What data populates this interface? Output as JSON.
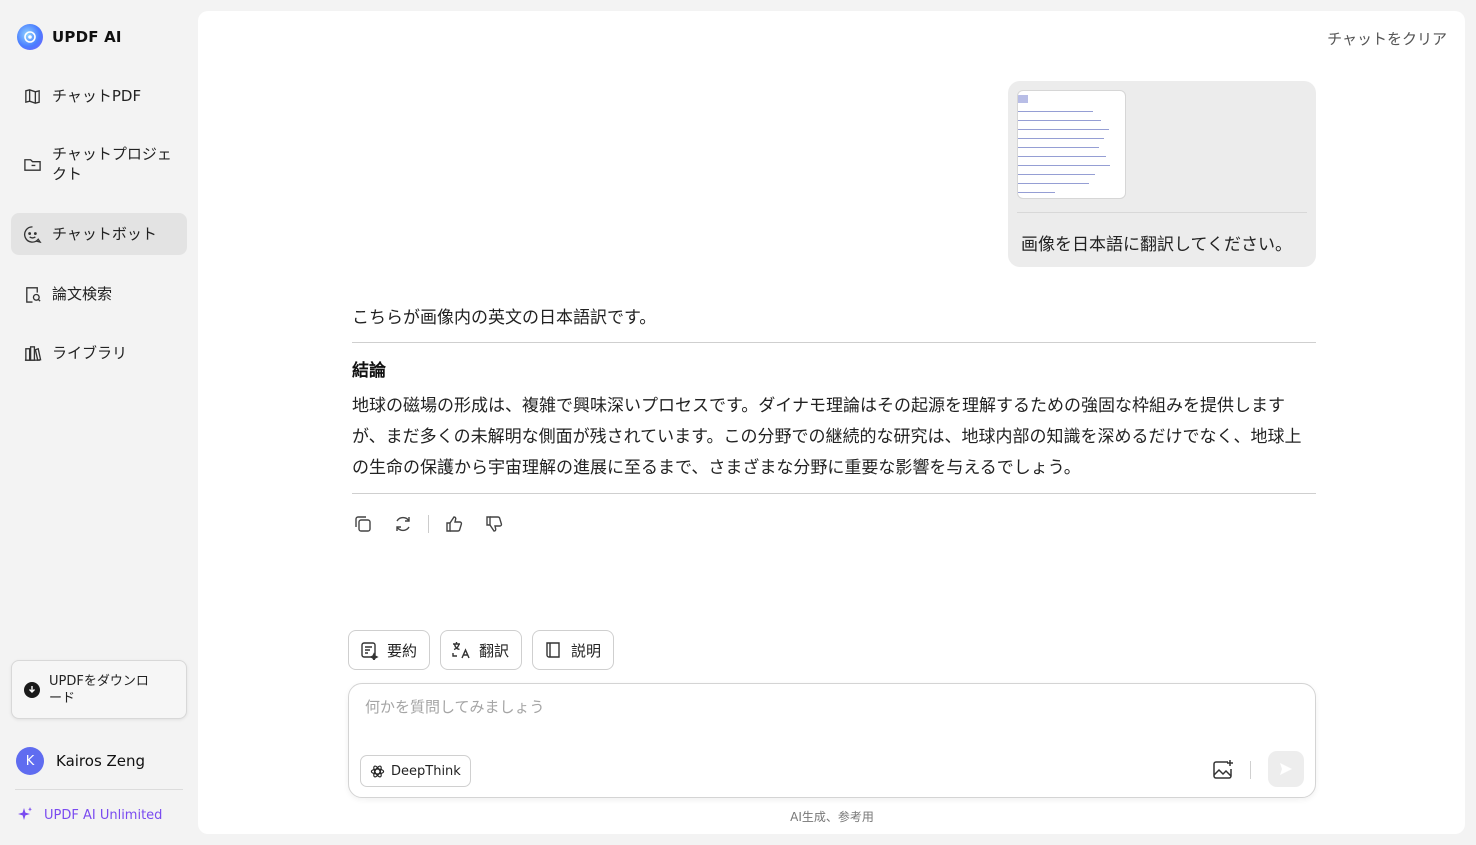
{
  "brand": {
    "name": "UPDF AI"
  },
  "sidebar": {
    "items": [
      {
        "label": "チャットPDF",
        "icon": "chat-pdf-icon"
      },
      {
        "label": "チャットプロジェクト",
        "icon": "folder-icon"
      },
      {
        "label": "チャットボット",
        "icon": "chatbot-icon"
      },
      {
        "label": "論文検索",
        "icon": "paper-search-icon"
      },
      {
        "label": "ライブラリ",
        "icon": "library-icon"
      }
    ],
    "active": "チャットボット",
    "download_label": "UPDFをダウンロード",
    "user": {
      "initial": "K",
      "name": "Kairos Zeng"
    },
    "plan": "UPDF AI Unlimited"
  },
  "header": {
    "clear_label": "チャットをクリア"
  },
  "conversation": {
    "user_message": "画像を日本語に翻訳してください。",
    "assistant": {
      "intro": "こちらが画像内の英文の日本語訳です。",
      "heading": "結論",
      "body": "地球の磁場の形成は、複雑で興味深いプロセスです。ダイナモ理論はその起源を理解するための強固な枠組みを提供しますが、まだ多くの未解明な側面が残されています。この分野での継続的な研究は、地球内部の知識を深めるだけでなく、地球上の生命の保護から宇宙理解の進展に至るまで、さまざまな分野に重要な影響を与えるでしょう。"
    }
  },
  "quick_actions": {
    "summarize": "要約",
    "translate": "翻訳",
    "explain": "説明"
  },
  "input": {
    "placeholder": "何かを質問してみましょう",
    "deepthink_label": "DeepThink"
  },
  "footer": {
    "disclaimer": "AI生成、参考用"
  },
  "colors": {
    "accent": "#7a4bf0",
    "avatar": "#5f6cf0",
    "active_bg": "#e3e3e3"
  }
}
